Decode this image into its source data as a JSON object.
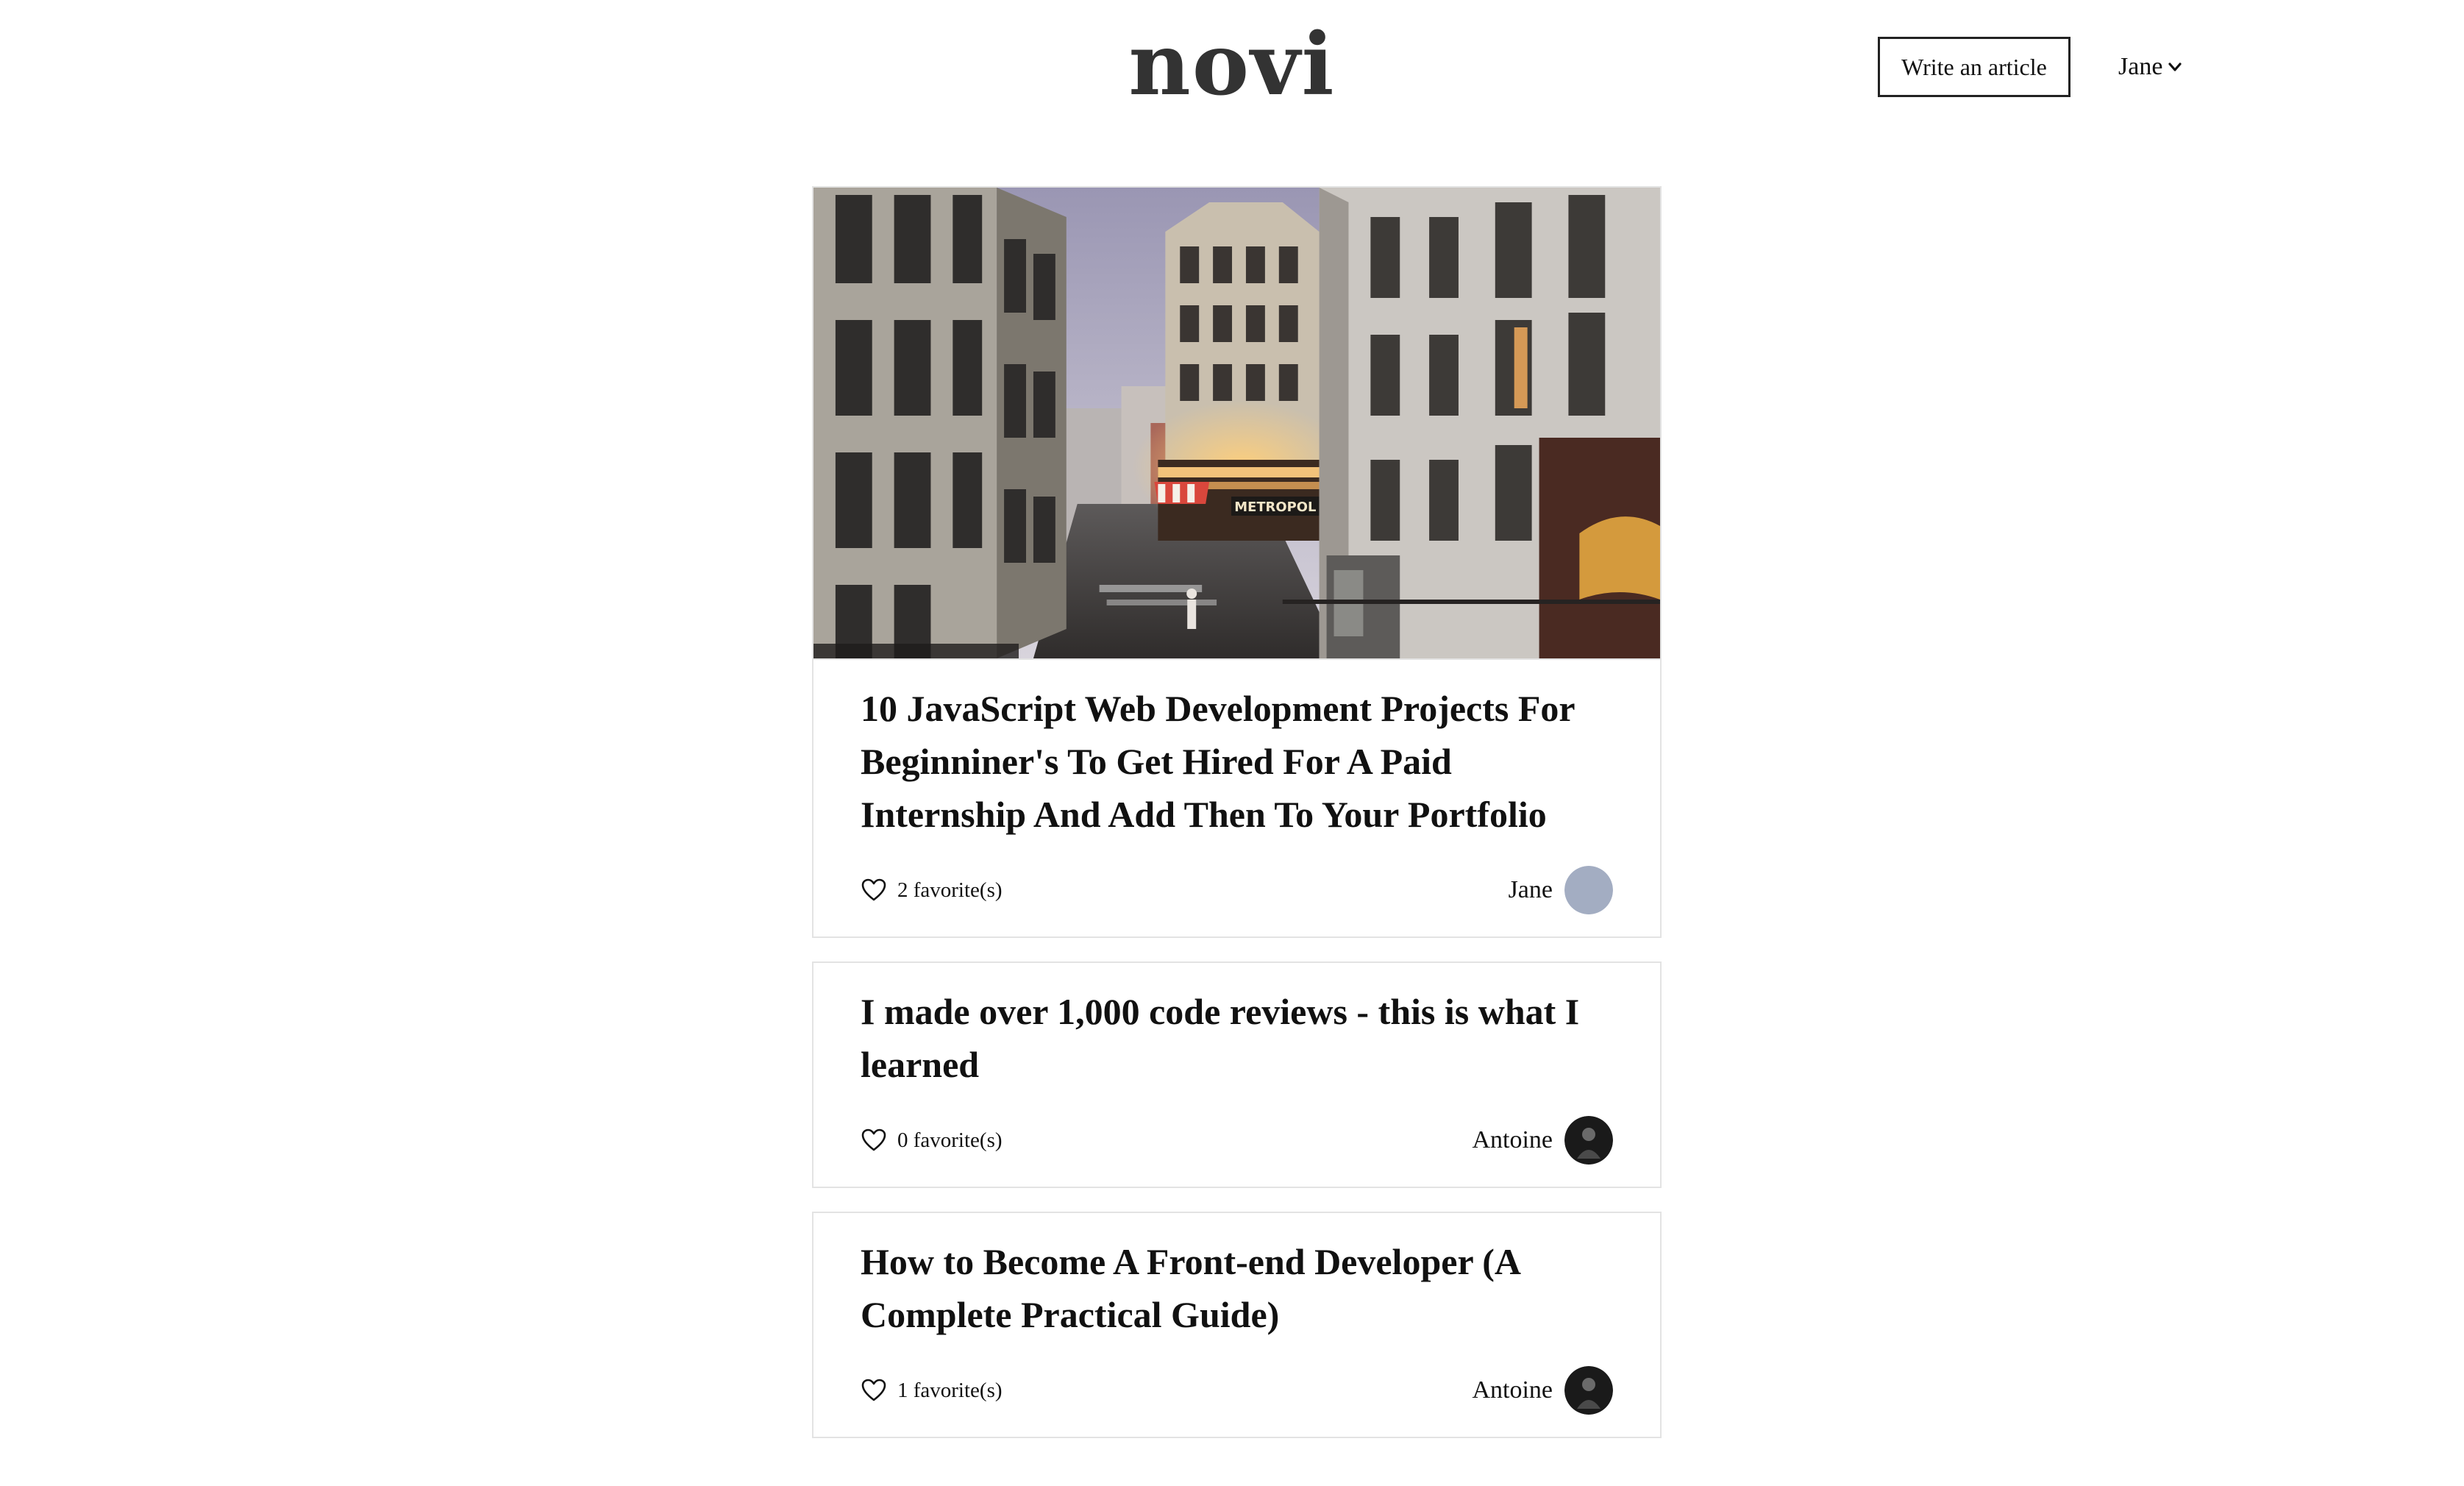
{
  "header": {
    "logo": "novi",
    "write_button": "Write an article",
    "user_name": "Jane",
    "user_menu_icon": "chevron-down-icon"
  },
  "articles": [
    {
      "title": "10 JavaScript Web Development Projects For Beginniner's To Get Hired For A Paid Internship And Add Then To Your Portfolio",
      "favorites": "2 favorite(s)",
      "author": "Jane",
      "has_image": true,
      "avatar_color": "#a3adc2"
    },
    {
      "title": "I made over 1,000 code reviews - this is what I learned",
      "favorites": "0 favorite(s)",
      "author": "Antoine",
      "has_image": false,
      "avatar_color": "#1a1a1a"
    },
    {
      "title": "How to Become A Front-end Developer (A Complete Practical Guide)",
      "favorites": "1 favorite(s)",
      "author": "Antoine",
      "has_image": false,
      "avatar_color": "#1a1a1a"
    }
  ],
  "colors": {
    "text": "#111111",
    "logo": "#333333",
    "card_border": "#e3e3e3",
    "jane_avatar": "#a3adc2",
    "antoine_avatar": "#1a1a1a"
  },
  "icons": {
    "favorite": "heart-icon",
    "dropdown": "chevron-down-icon"
  }
}
